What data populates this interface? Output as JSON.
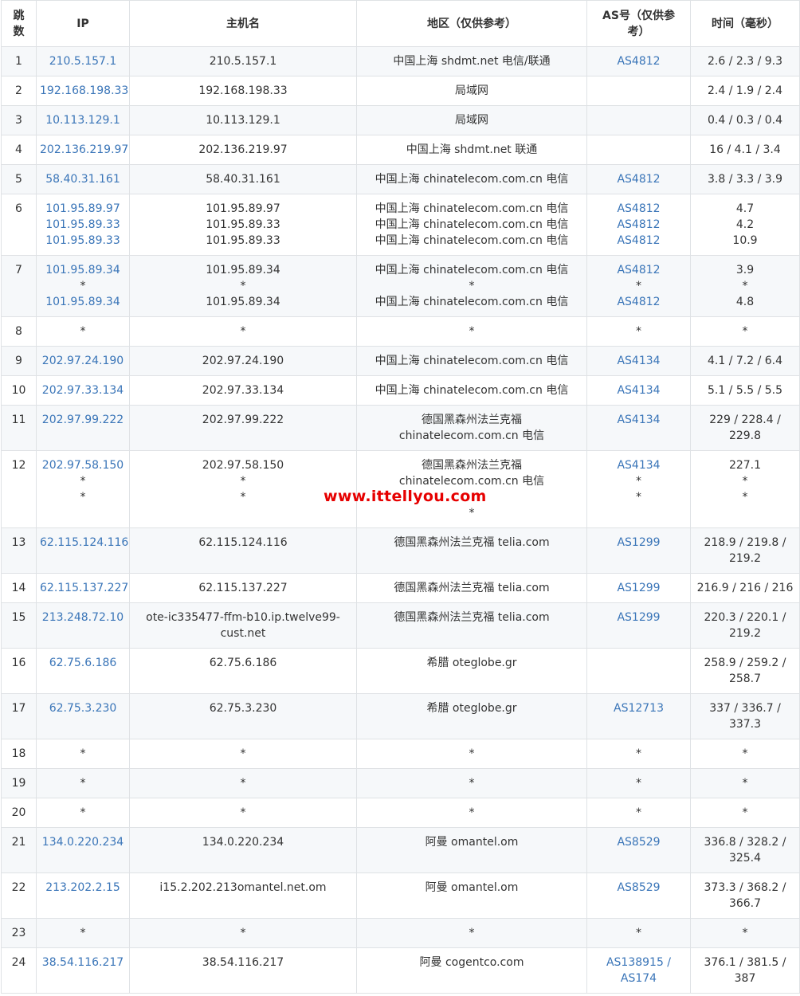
{
  "headers": {
    "hop": "跳数",
    "ip": "IP",
    "hostname": "主机名",
    "region": "地区（仅供参考）",
    "as": "AS号（仅供参考）",
    "time": "时间（毫秒）"
  },
  "watermark": "www.ittellyou.com",
  "colors": {
    "link": "#3a75b8",
    "watermark": "#e60000",
    "row_alt": "#f6f8fa",
    "border": "#dfe2e5"
  },
  "rows": [
    {
      "hop": "1",
      "ip": [
        "210.5.157.1"
      ],
      "host": [
        "210.5.157.1"
      ],
      "region": [
        "中国上海 shdmt.net 电信/联通"
      ],
      "as": [
        "AS4812"
      ],
      "time": [
        "2.6 / 2.3 / 9.3"
      ]
    },
    {
      "hop": "2",
      "ip": [
        "192.168.198.33"
      ],
      "host": [
        "192.168.198.33"
      ],
      "region": [
        "局域网"
      ],
      "as": [],
      "time": [
        "2.4 / 1.9 / 2.4"
      ]
    },
    {
      "hop": "3",
      "ip": [
        "10.113.129.1"
      ],
      "host": [
        "10.113.129.1"
      ],
      "region": [
        "局域网"
      ],
      "as": [],
      "time": [
        "0.4 / 0.3 / 0.4"
      ]
    },
    {
      "hop": "4",
      "ip": [
        "202.136.219.97"
      ],
      "host": [
        "202.136.219.97"
      ],
      "region": [
        "中国上海 shdmt.net 联通"
      ],
      "as": [],
      "time": [
        "16 / 4.1 / 3.4"
      ]
    },
    {
      "hop": "5",
      "ip": [
        "58.40.31.161"
      ],
      "host": [
        "58.40.31.161"
      ],
      "region": [
        "中国上海 chinatelecom.com.cn 电信"
      ],
      "as": [
        "AS4812"
      ],
      "time": [
        "3.8 / 3.3 / 3.9"
      ]
    },
    {
      "hop": "6",
      "ip": [
        "101.95.89.97",
        "101.95.89.33",
        "101.95.89.33"
      ],
      "host": [
        "101.95.89.97",
        "101.95.89.33",
        "101.95.89.33"
      ],
      "region": [
        "中国上海 chinatelecom.com.cn 电信",
        "中国上海 chinatelecom.com.cn 电信",
        "中国上海 chinatelecom.com.cn 电信"
      ],
      "as": [
        "AS4812",
        "AS4812",
        "AS4812"
      ],
      "time": [
        "4.7",
        "4.2",
        "10.9"
      ]
    },
    {
      "hop": "7",
      "ip": [
        "101.95.89.34",
        "*",
        "101.95.89.34"
      ],
      "host": [
        "101.95.89.34",
        "*",
        "101.95.89.34"
      ],
      "region": [
        "中国上海 chinatelecom.com.cn 电信",
        "*",
        "中国上海 chinatelecom.com.cn 电信"
      ],
      "as": [
        "AS4812",
        "*",
        "AS4812"
      ],
      "time": [
        "3.9",
        "*",
        "4.8"
      ]
    },
    {
      "hop": "8",
      "ip": [
        "*"
      ],
      "host": [
        "*"
      ],
      "region": [
        "*"
      ],
      "as": [
        "*"
      ],
      "time": [
        "*"
      ]
    },
    {
      "hop": "9",
      "ip": [
        "202.97.24.190"
      ],
      "host": [
        "202.97.24.190"
      ],
      "region": [
        "中国上海 chinatelecom.com.cn 电信"
      ],
      "as": [
        "AS4134"
      ],
      "time": [
        "4.1 / 7.2 / 6.4"
      ]
    },
    {
      "hop": "10",
      "ip": [
        "202.97.33.134"
      ],
      "host": [
        "202.97.33.134"
      ],
      "region": [
        "中国上海 chinatelecom.com.cn 电信"
      ],
      "as": [
        "AS4134"
      ],
      "time": [
        "5.1 / 5.5 / 5.5"
      ]
    },
    {
      "hop": "11",
      "ip": [
        "202.97.99.222"
      ],
      "host": [
        "202.97.99.222"
      ],
      "region": [
        "德国黑森州法兰克福 chinatelecom.com.cn 电信"
      ],
      "as": [
        "AS4134"
      ],
      "time": [
        "229 / 228.4 / 229.8"
      ]
    },
    {
      "hop": "12",
      "ip": [
        "202.97.58.150",
        "*",
        "*"
      ],
      "host": [
        "202.97.58.150",
        "*",
        "*"
      ],
      "region": [
        "德国黑森州法兰克福 chinatelecom.com.cn 电信",
        "",
        "*"
      ],
      "as": [
        "AS4134",
        "*",
        "*"
      ],
      "time": [
        "227.1",
        "*",
        "*"
      ]
    },
    {
      "hop": "13",
      "ip": [
        "62.115.124.116"
      ],
      "host": [
        "62.115.124.116"
      ],
      "region": [
        "德国黑森州法兰克福 telia.com"
      ],
      "as": [
        "AS1299"
      ],
      "time": [
        "218.9 / 219.8 / 219.2"
      ]
    },
    {
      "hop": "14",
      "ip": [
        "62.115.137.227"
      ],
      "host": [
        "62.115.137.227"
      ],
      "region": [
        "德国黑森州法兰克福 telia.com"
      ],
      "as": [
        "AS1299"
      ],
      "time": [
        "216.9 / 216 / 216"
      ]
    },
    {
      "hop": "15",
      "ip": [
        "213.248.72.10"
      ],
      "host": [
        "ote-ic335477-ffm-b10.ip.twelve99-cust.net"
      ],
      "region": [
        "德国黑森州法兰克福 telia.com"
      ],
      "as": [
        "AS1299"
      ],
      "time": [
        "220.3 / 220.1 / 219.2"
      ]
    },
    {
      "hop": "16",
      "ip": [
        "62.75.6.186"
      ],
      "host": [
        "62.75.6.186"
      ],
      "region": [
        "希腊 oteglobe.gr"
      ],
      "as": [],
      "time": [
        "258.9 / 259.2 / 258.7"
      ]
    },
    {
      "hop": "17",
      "ip": [
        "62.75.3.230"
      ],
      "host": [
        "62.75.3.230"
      ],
      "region": [
        "希腊 oteglobe.gr"
      ],
      "as": [
        "AS12713"
      ],
      "time": [
        "337 / 336.7 / 337.3"
      ]
    },
    {
      "hop": "18",
      "ip": [
        "*"
      ],
      "host": [
        "*"
      ],
      "region": [
        "*"
      ],
      "as": [
        "*"
      ],
      "time": [
        "*"
      ]
    },
    {
      "hop": "19",
      "ip": [
        "*"
      ],
      "host": [
        "*"
      ],
      "region": [
        "*"
      ],
      "as": [
        "*"
      ],
      "time": [
        "*"
      ]
    },
    {
      "hop": "20",
      "ip": [
        "*"
      ],
      "host": [
        "*"
      ],
      "region": [
        "*"
      ],
      "as": [
        "*"
      ],
      "time": [
        "*"
      ]
    },
    {
      "hop": "21",
      "ip": [
        "134.0.220.234"
      ],
      "host": [
        "134.0.220.234"
      ],
      "region": [
        "阿曼 omantel.om"
      ],
      "as": [
        "AS8529"
      ],
      "time": [
        "336.8 / 328.2 / 325.4"
      ]
    },
    {
      "hop": "22",
      "ip": [
        "213.202.2.15"
      ],
      "host": [
        "i15.2.202.213omantel.net.om"
      ],
      "region": [
        "阿曼 omantel.om"
      ],
      "as": [
        "AS8529"
      ],
      "time": [
        "373.3 / 368.2 / 366.7"
      ]
    },
    {
      "hop": "23",
      "ip": [
        "*"
      ],
      "host": [
        "*"
      ],
      "region": [
        "*"
      ],
      "as": [
        "*"
      ],
      "time": [
        "*"
      ]
    },
    {
      "hop": "24",
      "ip": [
        "38.54.116.217"
      ],
      "host": [
        "38.54.116.217"
      ],
      "region": [
        "阿曼 cogentco.com"
      ],
      "as": [
        "AS138915 / AS174"
      ],
      "time": [
        "376.1 / 381.5 / 387"
      ]
    }
  ]
}
